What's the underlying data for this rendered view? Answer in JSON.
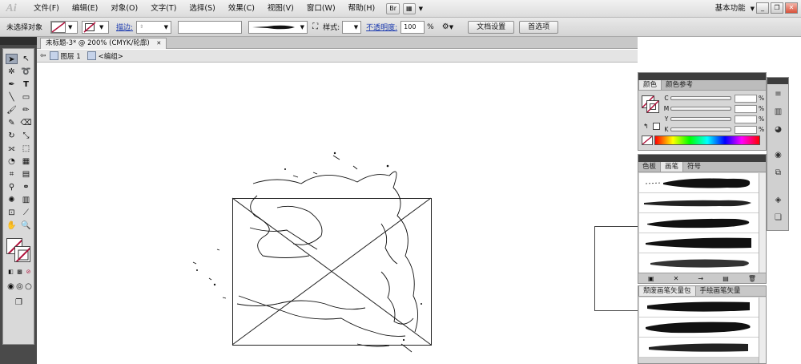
{
  "app": {
    "logo": "Ai",
    "workspace": "基本功能",
    "workspace_arrow": "▼"
  },
  "menu": [
    "文件(F)",
    "编辑(E)",
    "对象(O)",
    "文字(T)",
    "选择(S)",
    "效果(C)",
    "视图(V)",
    "窗口(W)",
    "帮助(H)"
  ],
  "menu_extra": {
    "bridge": "Br",
    "arrange": "▦",
    "arrange_arrow": "▼"
  },
  "window_buttons": [
    "_",
    "❐",
    "✕"
  ],
  "control_bar": {
    "selection_label": "未选择对象",
    "stroke_label": "描边:",
    "style_label": "样式:",
    "opacity_label": "不透明度:",
    "opacity_value": "100",
    "opacity_unit": "%",
    "doc_settings": "文档设置",
    "preferences": "首选项"
  },
  "document_tab": {
    "label": "未标题-3* @ 200% (CMYK/轮廓)",
    "close": "✕"
  },
  "breadcrumb": {
    "layer": "图层 1",
    "group": "<编组>"
  },
  "color_panel": {
    "tabs": [
      "颜色",
      "颜色参考"
    ],
    "channels": [
      "C",
      "M",
      "Y",
      "K"
    ],
    "unit": "%"
  },
  "brush_panel": {
    "tabs": [
      "色板",
      "画笔",
      "符号"
    ],
    "footer_icons": [
      "▣",
      "✕",
      "→",
      "▤",
      "🗑"
    ]
  },
  "lib_panel": {
    "tabs": [
      "颓废画笔矢量包",
      "手绘画笔矢量"
    ]
  },
  "colors": {
    "accent_fill_slash": "#b0103a",
    "panel_dark": "#3d3d3d",
    "link": "#1a3ab0"
  }
}
